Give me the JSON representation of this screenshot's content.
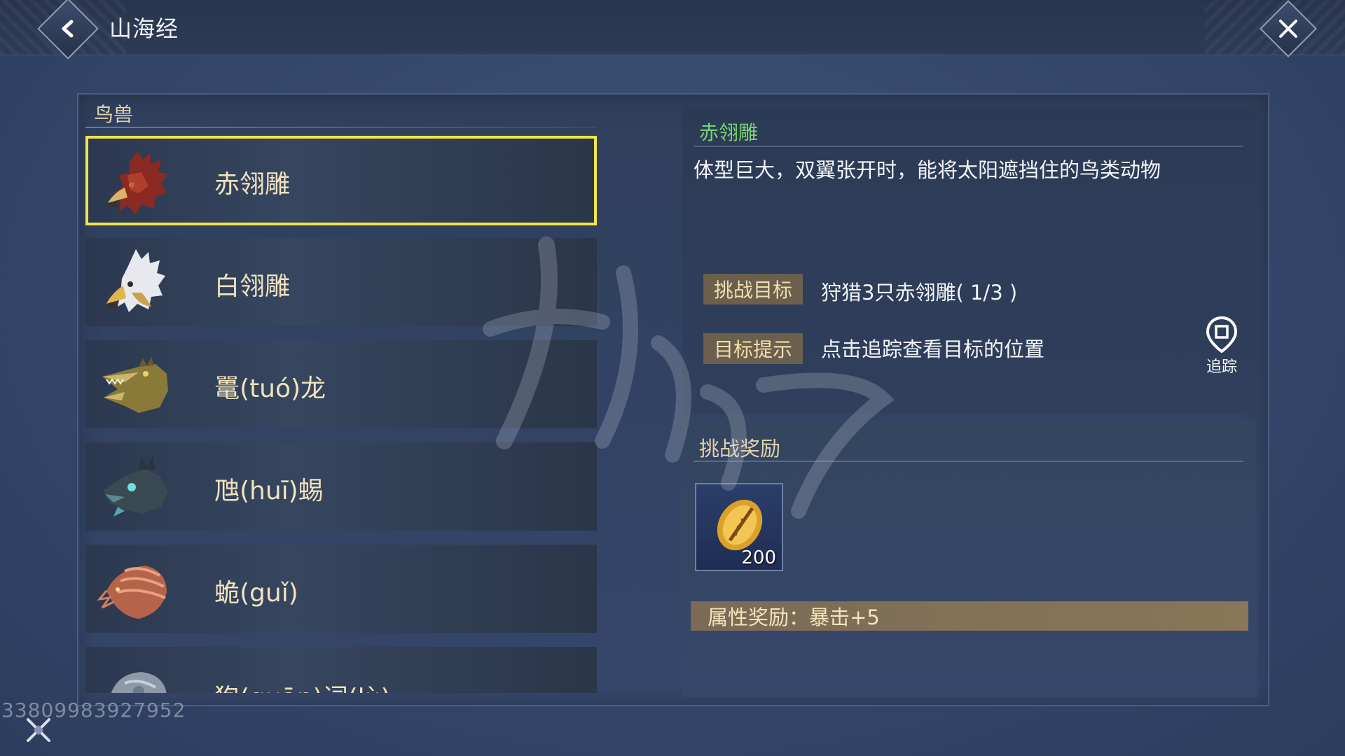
{
  "header": {
    "title": "山海经"
  },
  "category": {
    "label": "鸟兽"
  },
  "creatures": [
    {
      "name": "赤翎雕",
      "selected": true,
      "icon": "red-eagle-portrait"
    },
    {
      "name": "白翎雕",
      "selected": false,
      "icon": "white-eagle-portrait"
    },
    {
      "name": "鼍(tuó)龙",
      "selected": false,
      "icon": "crocodile-dragon-portrait"
    },
    {
      "name": "虺(huī)蜴",
      "selected": false,
      "icon": "lizard-portrait"
    },
    {
      "name": "蛫(guǐ)",
      "selected": false,
      "icon": "shrimp-beast-portrait"
    },
    {
      "name": "狍(quān)词(lù)",
      "selected": false,
      "icon": "stone-beast-portrait"
    }
  ],
  "detail": {
    "title": "赤翎雕",
    "description": "体型巨大，双翼张开时，能将太阳遮挡住的鸟类动物",
    "challenge_tag": "挑战目标",
    "challenge_text": "狩猎3只赤翎雕( 1/3 )",
    "hint_tag": "目标提示",
    "hint_text": "点击追踪查看目标的位置",
    "track_label": "追踪"
  },
  "rewards": {
    "title": "挑战奖励",
    "item_icon": "golden-shell-icon",
    "item_count": "200",
    "attribute": "属性奖励：暴击+5"
  },
  "footer": {
    "uid": "33809983927952"
  },
  "colors": {
    "selected_border": "#f2e44a",
    "detail_title": "#79d472",
    "tag_bg": "#6b5f4d",
    "attr_bar_bg": "#8a7658"
  }
}
